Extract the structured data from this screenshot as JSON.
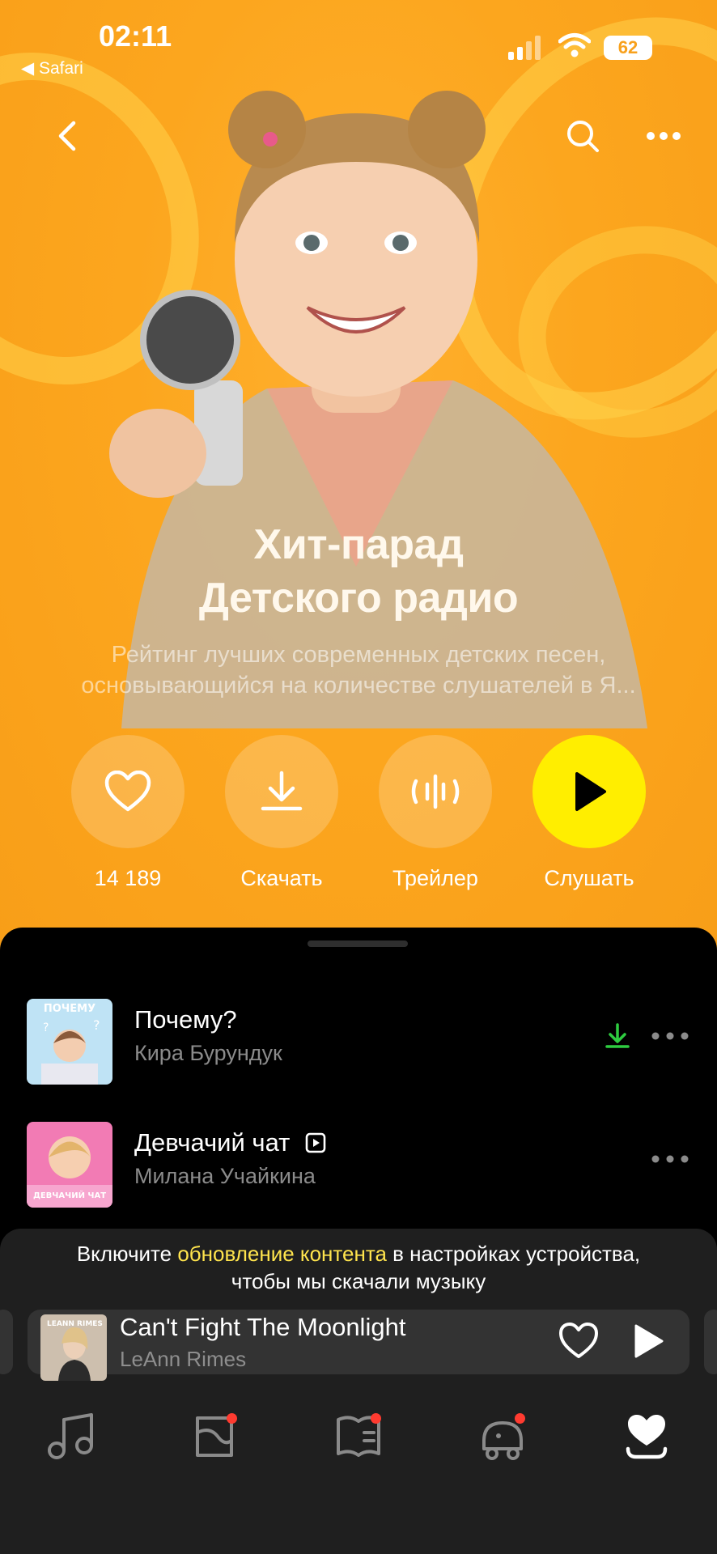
{
  "status_bar": {
    "time": "02:11",
    "back_app": "◀ Safari",
    "battery": "62"
  },
  "playlist": {
    "title_line1": "Хит-парад",
    "title_line2": "Детского радио",
    "description_line1": "Рейтинг лучших современных детских песен,",
    "description_line2": "основывающийся на количестве слушателей в Я..."
  },
  "actions": [
    {
      "label": "14 189",
      "icon": "heart-icon"
    },
    {
      "label": "Скачать",
      "icon": "download-icon"
    },
    {
      "label": "Трейлер",
      "icon": "waveform-icon"
    },
    {
      "label": "Слушать",
      "icon": "play-icon"
    }
  ],
  "tracks": [
    {
      "title": "Почему?",
      "artist": "Кира Бурундук",
      "cover_text": "ПОЧЕМУ",
      "downloaded": true
    },
    {
      "title": "Девчачий чат",
      "artist": "Милана Учайкина",
      "cover_text": "ДЕВЧАЧИЙ ЧАТ",
      "has_video": true
    }
  ],
  "notice": {
    "before": "Включите ",
    "highlight": "обновление контента",
    "after": " в настройках устройства,",
    "line2": "чтобы мы скачали музыку"
  },
  "mini_player": {
    "title": "Can't Fight The Moonlight",
    "artist": "LeAnn Rimes",
    "cover_text": "LEANN RIMES"
  },
  "tabs": [
    {
      "icon": "music-note-icon",
      "badge": false
    },
    {
      "icon": "map-icon",
      "badge": true
    },
    {
      "icon": "book-icon",
      "badge": true
    },
    {
      "icon": "kids-icon",
      "badge": true
    },
    {
      "icon": "collection-heart-icon",
      "badge": false
    }
  ],
  "colors": {
    "accent": "#ffee00",
    "hero_bg": "#fca61e",
    "download_green": "#2ecc40",
    "badge_red": "#ff3b30",
    "highlight": "#ffe44d"
  }
}
